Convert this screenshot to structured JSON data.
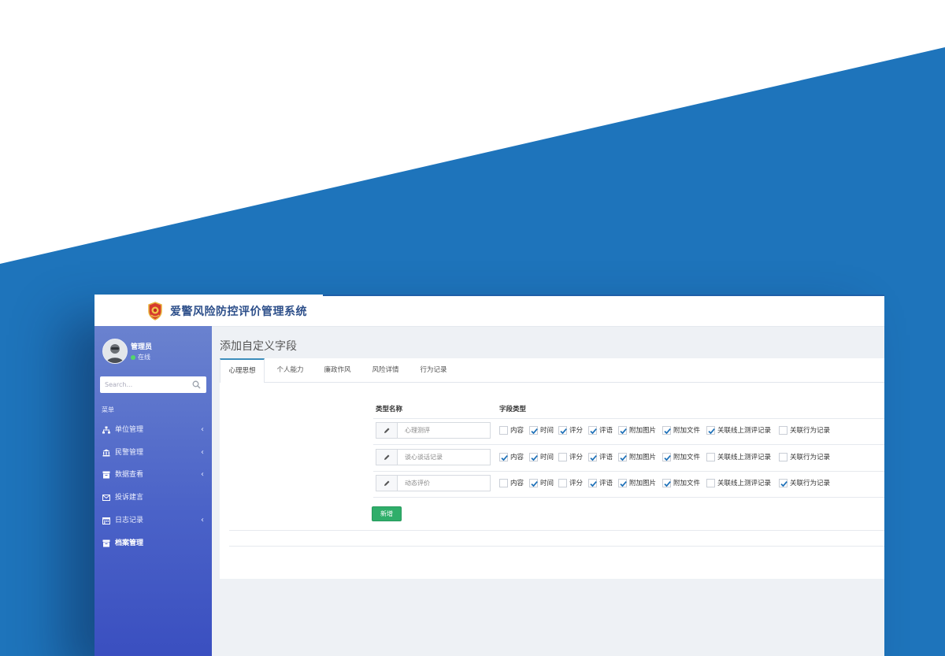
{
  "app": {
    "title": "爱警风险防控评价管理系统",
    "accent_color": "#1f5fa8"
  },
  "user": {
    "name": "管理员",
    "status": "在线",
    "status_color": "#53d769"
  },
  "search": {
    "placeholder": "Search..."
  },
  "sidebar": {
    "menu_header": "菜单",
    "items": [
      {
        "label": "单位管理",
        "icon": "sitemap-icon",
        "has_chevron": true
      },
      {
        "label": "民警管理",
        "icon": "bank-icon",
        "has_chevron": true
      },
      {
        "label": "数据查看",
        "icon": "archive-icon",
        "has_chevron": true
      },
      {
        "label": "投诉建言",
        "icon": "envelope-icon",
        "has_chevron": false
      },
      {
        "label": "日志记录",
        "icon": "calendar-icon",
        "has_chevron": true
      },
      {
        "label": "档案管理",
        "icon": "folder-icon",
        "has_chevron": false,
        "active": true
      }
    ],
    "chevron": "‹"
  },
  "page": {
    "title": "添加自定义字段"
  },
  "tabs": [
    {
      "label": "心理思想",
      "active": true
    },
    {
      "label": "个人能力"
    },
    {
      "label": "廉政作风"
    },
    {
      "label": "风险详情"
    },
    {
      "label": "行为记录"
    }
  ],
  "table": {
    "col_name": "类型名称",
    "col_types": "字段类型",
    "rows": [
      {
        "name": "心理测评",
        "options": [
          {
            "label": "内容",
            "checked": false
          },
          {
            "label": "时间",
            "checked": true
          },
          {
            "label": "评分",
            "checked": true
          },
          {
            "label": "评语",
            "checked": true
          },
          {
            "label": "附加图片",
            "checked": true
          },
          {
            "label": "附加文件",
            "checked": true
          },
          {
            "label": "关联线上测评记录",
            "checked": true
          },
          {
            "label": "关联行为记录",
            "checked": false
          }
        ]
      },
      {
        "name": "谈心谈话记录",
        "options": [
          {
            "label": "内容",
            "checked": true
          },
          {
            "label": "时间",
            "checked": true
          },
          {
            "label": "评分",
            "checked": false
          },
          {
            "label": "评语",
            "checked": true
          },
          {
            "label": "附加图片",
            "checked": true
          },
          {
            "label": "附加文件",
            "checked": true
          },
          {
            "label": "关联线上测评记录",
            "checked": false
          },
          {
            "label": "关联行为记录",
            "checked": false
          }
        ]
      },
      {
        "name": "动态评价",
        "options": [
          {
            "label": "内容",
            "checked": false
          },
          {
            "label": "时间",
            "checked": true
          },
          {
            "label": "评分",
            "checked": false
          },
          {
            "label": "评语",
            "checked": true
          },
          {
            "label": "附加图片",
            "checked": true
          },
          {
            "label": "附加文件",
            "checked": true
          },
          {
            "label": "关联线上测评记录",
            "checked": false
          },
          {
            "label": "关联行为记录",
            "checked": true
          }
        ]
      }
    ]
  },
  "add_button": {
    "label": "新增",
    "color": "#2fae6a"
  },
  "background": {
    "blue": "#1e74bb",
    "white": "#ffffff"
  }
}
